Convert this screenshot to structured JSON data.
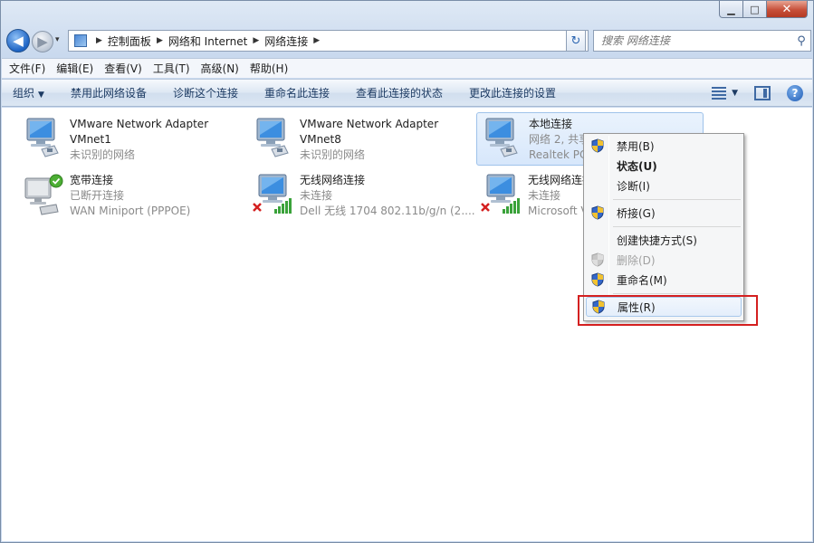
{
  "window": {
    "caption": {
      "minimize": "▁",
      "maximize": "□",
      "close": "✕"
    }
  },
  "navigation": {
    "back_glyph": "◀",
    "forward_glyph": "▶",
    "history_glyph": "▾",
    "breadcrumbs": [
      "控制面板",
      "网络和 Internet",
      "网络连接"
    ],
    "crumb_separator": "▶",
    "refresh_glyph": "↻",
    "search_placeholder": "搜索 网络连接",
    "search_glyph": "⚲"
  },
  "menubar": [
    "文件(F)",
    "编辑(E)",
    "查看(V)",
    "工具(T)",
    "高级(N)",
    "帮助(H)"
  ],
  "commandbar": {
    "organize": "组织",
    "items": [
      "禁用此网络设备",
      "诊断这个连接",
      "重命名此连接",
      "查看此连接的状态",
      "更改此连接的设置"
    ],
    "dropdown_glyph": "▼",
    "help_glyph": "?"
  },
  "connections": [
    {
      "name": "VMware Network Adapter",
      "line2": "VMnet1",
      "line3": "未识别的网络",
      "status": "connected",
      "selected": false
    },
    {
      "name": "VMware Network Adapter",
      "line2": "VMnet8",
      "line3": "未识别的网络",
      "status": "connected",
      "selected": false
    },
    {
      "name": "本地连接",
      "line2": "网络  2, 共享",
      "line3": "Realtek PCIe",
      "status": "connected",
      "selected": true
    },
    {
      "name": "宽带连接",
      "line2": "已断开连接",
      "line3": "WAN Miniport (PPPOE)",
      "status": "broadband",
      "selected": false
    },
    {
      "name": "无线网络连接",
      "line2": "未连接",
      "line3": "Dell 无线 1704 802.11b/g/n (2....",
      "status": "wireless-disconnected",
      "selected": false
    },
    {
      "name": "无线网络连接",
      "line2": "未连接",
      "line3": "Microsoft Virtual",
      "status": "wireless-disconnected",
      "selected": false
    }
  ],
  "context_menu": [
    {
      "label": "禁用(B)",
      "icon": "shield-icon",
      "bold": false,
      "disabled": false
    },
    {
      "label": "状态(U)",
      "icon": "",
      "bold": true,
      "disabled": false
    },
    {
      "label": "诊断(I)",
      "icon": "",
      "bold": false,
      "disabled": false
    },
    {
      "label": "桥接(G)",
      "icon": "shield-icon",
      "bold": false,
      "disabled": false
    },
    {
      "label": "创建快捷方式(S)",
      "icon": "",
      "bold": false,
      "disabled": false
    },
    {
      "label": "删除(D)",
      "icon": "shield-icon",
      "bold": false,
      "disabled": true
    },
    {
      "label": "重命名(M)",
      "icon": "shield-icon",
      "bold": false,
      "disabled": false
    },
    {
      "label": "属性(R)",
      "icon": "shield-icon",
      "bold": false,
      "disabled": false,
      "hover": true
    }
  ],
  "colors": {
    "accent": "#3399ff",
    "highlight_box": "#d42020",
    "disconnected_x": "#d42020",
    "signal_green": "#3aa23a",
    "check_green": "#4cae34"
  }
}
